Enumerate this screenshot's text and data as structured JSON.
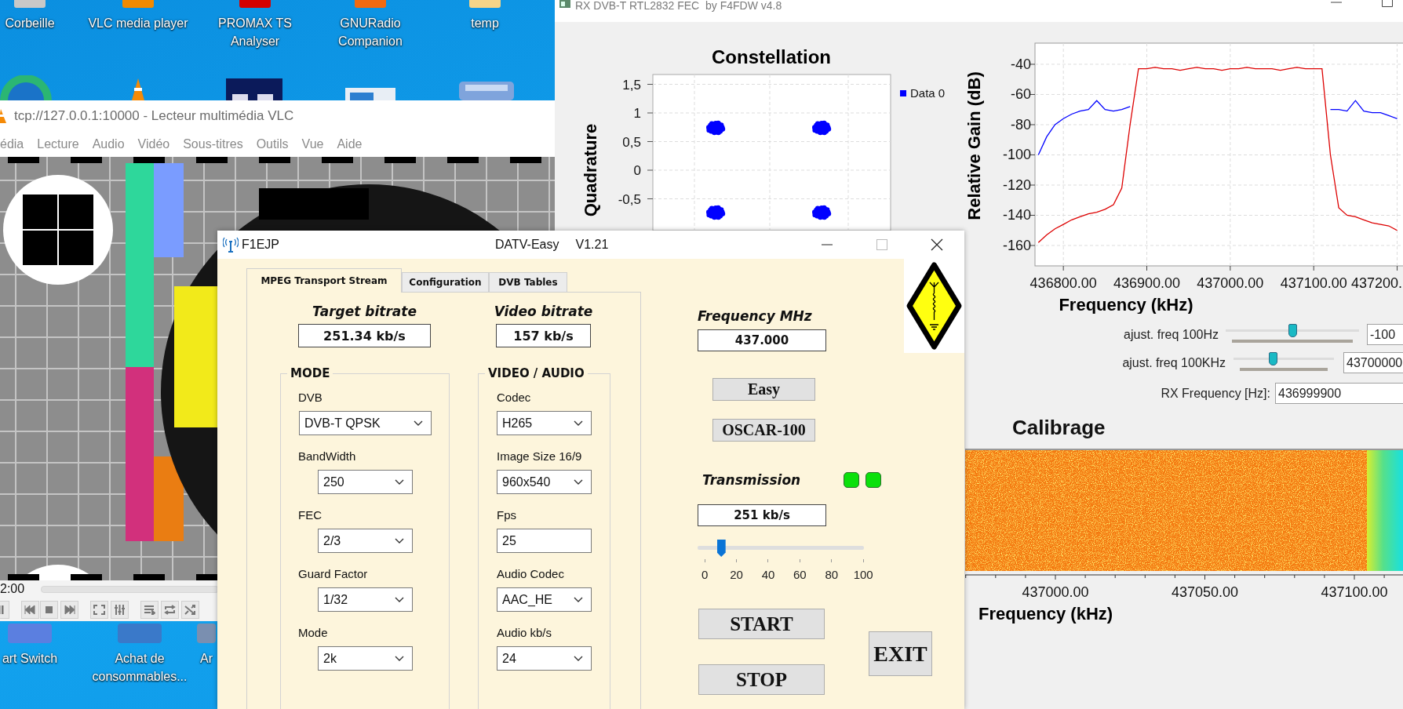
{
  "desktop": {
    "icons": [
      {
        "label": "Corbeille"
      },
      {
        "label": "VLC media player"
      },
      {
        "label": "PROMAX TS Analyser"
      },
      {
        "label": "GNURadio Companion"
      },
      {
        "label": "temp"
      }
    ],
    "lower_icons": [
      {
        "label": "art Switch"
      },
      {
        "label": "Achat de consommables..."
      },
      {
        "label": "Ar"
      }
    ]
  },
  "vlc_window": {
    "title": "tcp://127.0.0.1:10000 - Lecteur multimédia VLC",
    "menu": [
      "édia",
      "Lecture",
      "Audio",
      "Vidéo",
      "Sous-titres",
      "Outils",
      "Vue",
      "Aide"
    ],
    "time": "2:00"
  },
  "rx_window": {
    "title": "RX DVB-T RTL2832 FEC  by F4FDW v4.8",
    "constellation": {
      "title": "Constellation",
      "ylabel": "Quadrature",
      "legend": "Data 0",
      "yticks": [
        "1,5",
        "1",
        "0,5",
        "0",
        "-0,5"
      ]
    },
    "spectrum": {
      "chart_data": {
        "type": "line",
        "grid": true,
        "xlabel": "Frequency (kHz)",
        "ylabel": "Relative Gain (dB)",
        "xlim": [
          436766,
          437207
        ],
        "ylim": [
          -173.5,
          -26
        ],
        "xticks": [
          {
            "value": 436800,
            "label": "436800.00"
          },
          {
            "value": 436900,
            "label": "436900.00"
          },
          {
            "value": 437000,
            "label": "437000.00"
          },
          {
            "value": 437100,
            "label": "437100.00"
          },
          {
            "value": 437200,
            "label": "437200."
          }
        ],
        "yticks": [
          -40,
          -60,
          -80,
          -100,
          -120,
          -140,
          -160
        ],
        "x": [
          436770,
          436780,
          436790,
          436800,
          436810,
          436820,
          436830,
          436840,
          436850,
          436860,
          436870,
          436880,
          436890,
          436900,
          436910,
          436920,
          436930,
          436940,
          436950,
          436960,
          436970,
          436980,
          436990,
          437000,
          437010,
          437020,
          437030,
          437040,
          437050,
          437060,
          437070,
          437080,
          437090,
          437100,
          437110,
          437120,
          437130,
          437140,
          437150,
          437160,
          437170,
          437180,
          437190,
          437200
        ],
        "series": [
          {
            "color": "#0000ff",
            "values": [
              -100,
              -88,
              -80,
              -76,
              -73,
              -71,
              -70,
              -64,
              -70,
              -71,
              -70,
              -68,
              null,
              null,
              null,
              null,
              null,
              null,
              null,
              null,
              null,
              null,
              null,
              null,
              null,
              null,
              null,
              null,
              null,
              null,
              null,
              null,
              null,
              null,
              null,
              -70,
              -70,
              -71,
              -64,
              -71,
              -72,
              -72,
              -74,
              -76
            ]
          },
          {
            "color": "#dd0000",
            "values": [
              -158,
              -153,
              -149,
              -146,
              -143,
              -141,
              -139,
              -138,
              -136,
              -133,
              -122,
              -80,
              -43,
              -43,
              -42,
              -43,
              -43,
              -44,
              -43,
              -42,
              -43,
              -43,
              -44,
              -43,
              -43,
              -42,
              -43,
              -43,
              -43,
              -44,
              -43,
              -42,
              -43,
              -43,
              -43,
              -100,
              -135,
              -140,
              -141,
              -143,
              -145,
              -146,
              -147,
              -150
            ]
          }
        ]
      }
    },
    "controls": [
      {
        "kind": "slider",
        "label": "ajust. freq 100Hz",
        "level": 0.5,
        "value": "-100"
      },
      {
        "kind": "slider",
        "label": "ajust. freq 100KHz",
        "level": 0.38,
        "value": "43700000"
      },
      {
        "kind": "field",
        "label": "RX Frequency [Hz]:",
        "value": "436999900"
      }
    ],
    "calibrage": {
      "title": "Calibrage",
      "xticks": [
        "437000.00",
        "437050.00",
        "437100.00"
      ],
      "xlabel": "Frequency (kHz)"
    }
  },
  "datv_window": {
    "callsign": "F1EJP",
    "title": "DATV-Easy",
    "version": "V1.21",
    "tabs": [
      {
        "label": "MPEG Transport Stream",
        "selected": true
      },
      {
        "label": "Configuration",
        "selected": false
      },
      {
        "label": "DVB Tables",
        "selected": false
      }
    ],
    "target_bitrate": {
      "label": "Target bitrate",
      "value": "251.34 kb/s"
    },
    "video_bitrate": {
      "label": "Video bitrate",
      "value": "157 kb/s"
    },
    "groups": [
      {
        "title": "MODE",
        "fields": [
          {
            "label": "DVB",
            "value": "DVB-T QPSK",
            "kind": "dropdown"
          },
          {
            "label": "BandWidth",
            "value": "250",
            "kind": "dropdown"
          },
          {
            "label": "FEC",
            "value": "2/3",
            "kind": "dropdown"
          },
          {
            "label": "Guard Factor",
            "value": "1/32",
            "kind": "dropdown"
          },
          {
            "label": "Mode",
            "value": "2k",
            "kind": "dropdown"
          }
        ]
      },
      {
        "title": "VIDEO / AUDIO",
        "fields": [
          {
            "label": "Codec",
            "value": "H265",
            "kind": "dropdown"
          },
          {
            "label": "Image Size 16/9",
            "value": "960x540",
            "kind": "dropdown"
          },
          {
            "label": "Fps",
            "value": "25",
            "kind": "text"
          },
          {
            "label": "Audio Codec",
            "value": "AAC_HE",
            "kind": "dropdown"
          },
          {
            "label": "Audio kb/s",
            "value": "24",
            "kind": "dropdown"
          }
        ]
      }
    ],
    "frequency": {
      "label": "Frequency MHz",
      "value": "437.000"
    },
    "preset_buttons": [
      "Easy",
      "OSCAR-100"
    ],
    "transmission": {
      "label": "Transmission",
      "leds": [
        {
          "on": true
        },
        {
          "on": true
        }
      ],
      "bitrate": "251 kb/s",
      "power": {
        "level": 0.11,
        "ticks": [
          "0",
          "20",
          "40",
          "60",
          "80",
          "100"
        ]
      }
    },
    "start": "START",
    "stop": "STOP",
    "exit": "EXIT"
  }
}
